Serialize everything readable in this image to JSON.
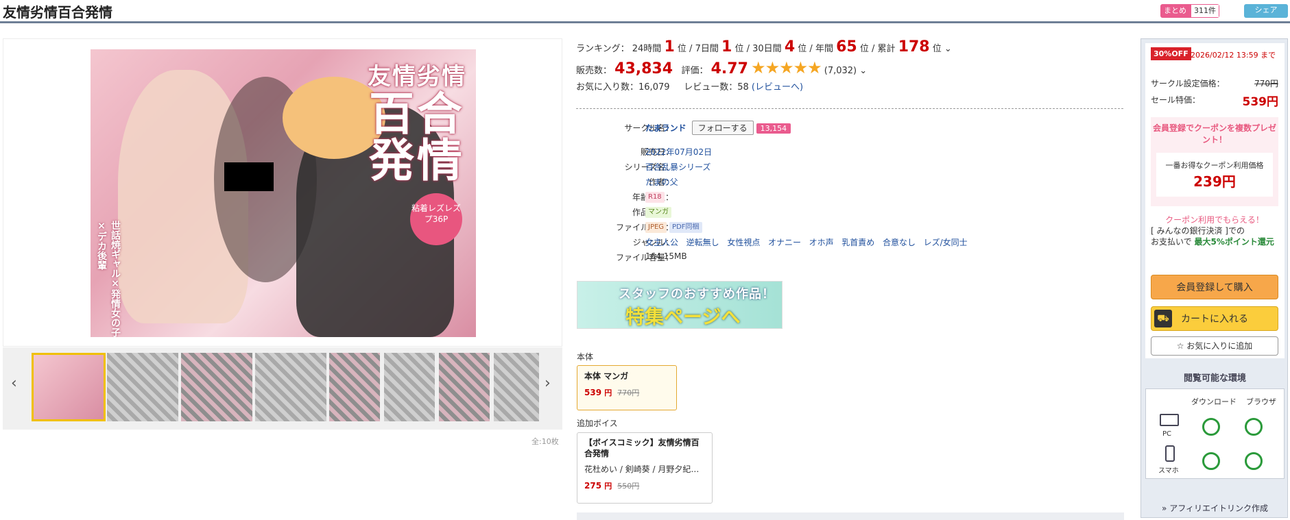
{
  "header": {
    "title": "友情劣情百合発情",
    "matome_label": "まとめ",
    "matome_count": "311件",
    "share_label": "シェア"
  },
  "cover": {
    "title_small": "友情劣情",
    "title_big1": "百合",
    "title_big2": "発情",
    "badge": "粘着レズレズプ36P",
    "vertical": "世話焼ギャル×発情女の子×デカ後輩"
  },
  "gallery": {
    "count": "全:10枚"
  },
  "ranking": {
    "label": "ランキング：",
    "h24_label": "24時間",
    "h24": "1",
    "d7_label": "7日間",
    "d7": "1",
    "d30_label": "30日間",
    "d30": "4",
    "year_label": "年間",
    "year": "65",
    "total_label": "累計",
    "total": "178",
    "unit": "位"
  },
  "sales": {
    "label": "販売数：",
    "value": "43,834",
    "rating_label": "評価：",
    "rating": "4.77",
    "stars": "★★★★★",
    "rating_count": "(7,032)"
  },
  "fav": {
    "label": "お気に入り数：",
    "value": "16,079",
    "review_label": "レビュー数：",
    "review_value": "58",
    "review_link": "(レビューへ)"
  },
  "details": {
    "circle_label": "サークル名：",
    "circle": "たまランド",
    "follow": "フォローする",
    "follow_count": "13,154",
    "release_label": "販売日：",
    "release": "2022年07月02日",
    "series_label": "シリーズ名：",
    "series": "百合乱暴シリーズ",
    "author_label": "作者：",
    "author": "たまの父",
    "age_label": "年齢指定：",
    "age": "R18",
    "format_label": "作品形式：",
    "format": "マンガ",
    "file_label": "ファイル形式：",
    "file1": "JPEG",
    "file2": "PDF同梱",
    "genre_label": "ジャンル：",
    "genres": [
      "女主人公",
      "逆転無し",
      "女性視点",
      "オナニー",
      "オホ声",
      "乳首責め",
      "合意なし",
      "レズ/女同士"
    ],
    "size_label": "ファイル容量：",
    "size": "164.15MB"
  },
  "banner": {
    "line1": "スタッフのおすすめ作品！",
    "line2": "特集ページへ"
  },
  "editions": {
    "main_label": "本体",
    "main_name": "本体 マンガ",
    "main_price": "539",
    "yen": "円",
    "main_old": "770円",
    "voice_label": "追加ボイス",
    "voice_name": "【ボイスコミック】友情劣情百合発情",
    "voice_cast": "花杜めい / 剣崎葵 / 月野夕紀…",
    "voice_price": "275",
    "voice_old": "550円"
  },
  "sidebar": {
    "off": "30%OFF",
    "until": "2026/02/12 13:59 まで",
    "set_label": "サークル設定価格：",
    "set_price": "770円",
    "sale_label": "セール特価：",
    "sale_price": "539円",
    "promo": "会員登録でクーポンを複数プレゼント！",
    "best_label": "一番お得なクーポン利用価格",
    "best_price": "239円",
    "coupon1": "クーポン利用でもらえる！",
    "coupon2": "[ みんなの銀行決済 ]での",
    "coupon3": "お支払いで",
    "coupon4": "最大5%ポイント還元",
    "buy": "会員登録して購入",
    "cart": "カートに入れる",
    "fav": "☆ お気に入りに追加",
    "env_title": "閲覧可能な環境",
    "env_dl": "ダウンロード",
    "env_br": "ブラウザ",
    "env_pc": "PC",
    "env_sp": "スマホ",
    "affiliate": "» アフィリエイトリンク作成"
  }
}
